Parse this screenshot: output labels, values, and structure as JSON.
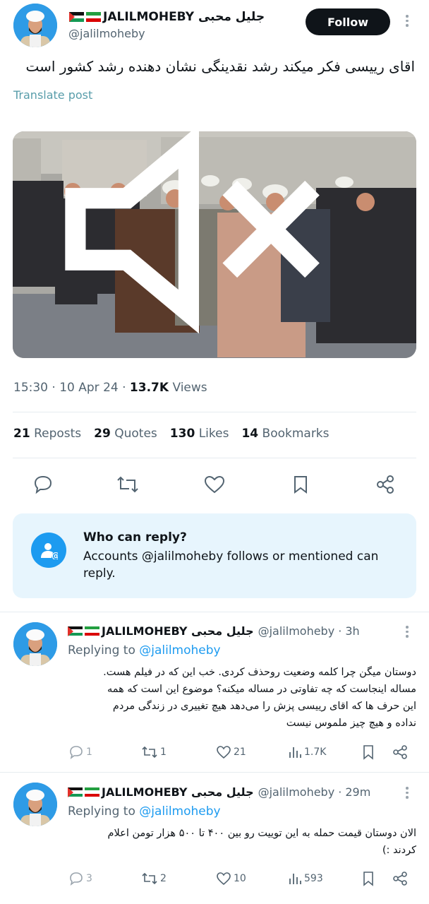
{
  "post": {
    "display_name": "JALILMOHEBY جلیل محبی",
    "handle": "@jalilmoheby",
    "follow_label": "Follow",
    "text": "اقای رییسی فکر میکند رشد نقدینگی نشان دهنده رشد کشور است",
    "translate_label": "Translate post",
    "time": "15:30",
    "date": "10 Apr 24",
    "views_count": "13.7K",
    "views_label": "Views",
    "stats": {
      "reposts_count": "21",
      "reposts_label": "Reposts",
      "quotes_count": "29",
      "quotes_label": "Quotes",
      "likes_count": "130",
      "likes_label": "Likes",
      "bookmarks_count": "14",
      "bookmarks_label": "Bookmarks"
    },
    "actions": [
      "reply-icon",
      "repost-icon",
      "like-icon",
      "bookmark-icon",
      "share-icon"
    ]
  },
  "who_can_reply": {
    "title": "Who can reply?",
    "description": "Accounts @jalilmoheby follows or mentioned can reply."
  },
  "replies": [
    {
      "display_name": "JALILMOHEBY جلیل محبی",
      "handle": "@jalilmoheby",
      "time": "· 3h",
      "replying_prefix": "Replying to",
      "replying_to": "@jalilmoheby",
      "text_lines": [
        "دوستان میگن چرا کلمه وضعیت روحذف کردی. خب این که در فیلم هست.",
        "مساله اینجاست که چه تفاوتی در مساله میکنه؟ موضوع این است که همه",
        "این حرف ها که اقای رییسی پزش را می‌دهد هیچ تغییری در زندگی مردم",
        "نداده و هیچ چیز ملموس نیست"
      ],
      "reply_count": "1",
      "repost_count": "1",
      "like_count": "21",
      "view_count": "1.7K"
    },
    {
      "display_name": "JALILMOHEBY جلیل محبی",
      "handle": "@jalilmoheby",
      "time": "· 29m",
      "replying_prefix": "Replying to",
      "replying_to": "@jalilmoheby",
      "text_lines": [
        "الان دوستان قیمت حمله به این توییت رو بین ۴۰۰ تا ۵۰۰ هزار تومن اعلام",
        "کردند :)"
      ],
      "reply_count": "3",
      "repost_count": "2",
      "like_count": "10",
      "view_count": "593"
    }
  ],
  "colors": {
    "accent": "#1d9bf0",
    "text_primary": "#0f1419",
    "text_secondary": "#536471",
    "reply_box_bg": "#e7f5fd",
    "follow_bg": "#0f1419"
  }
}
